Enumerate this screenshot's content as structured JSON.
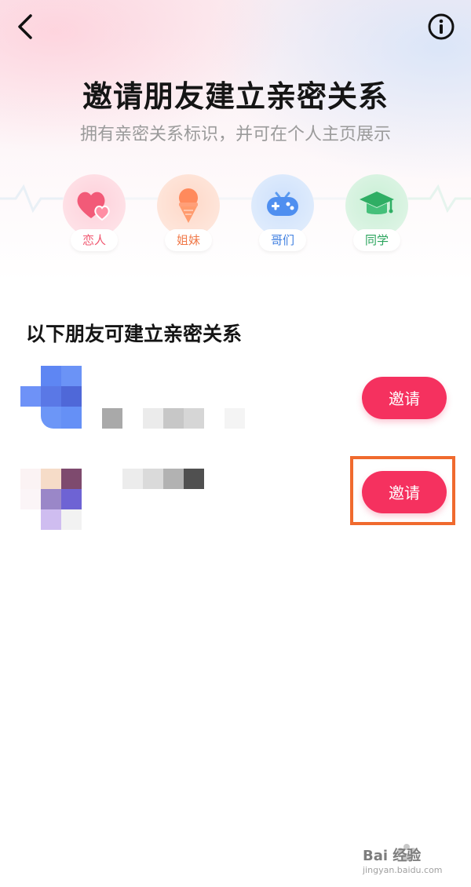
{
  "header": {
    "back_icon": "chevron-left-icon",
    "info_icon": "info-circle-icon",
    "title": "邀请朋友建立亲密关系",
    "subtitle": "拥有亲密关系标识，并可在个人主页展示"
  },
  "relations": [
    {
      "label": "恋人",
      "icon": "hearts-icon",
      "color": "#f0566f",
      "bg": "#fde3e8"
    },
    {
      "label": "姐妹",
      "icon": "ice-cream-icon",
      "color": "#f07a4a",
      "bg": "#fde6dc"
    },
    {
      "label": "哥们",
      "icon": "gamepad-icon",
      "color": "#3f7fe0",
      "bg": "#dfeafc"
    },
    {
      "label": "同学",
      "icon": "graduation-cap-icon",
      "color": "#2aa45c",
      "bg": "#dff4e6"
    }
  ],
  "friends_section": {
    "title": "以下朋友可建立亲密关系",
    "friends": [
      {
        "invite_label": "邀请"
      },
      {
        "invite_label": "邀请"
      }
    ]
  },
  "watermark": {
    "text": "Bai 经验",
    "sub": "jingyan.baidu.com"
  },
  "colors": {
    "accent": "#f5315f",
    "highlight": "#f06a2e"
  }
}
